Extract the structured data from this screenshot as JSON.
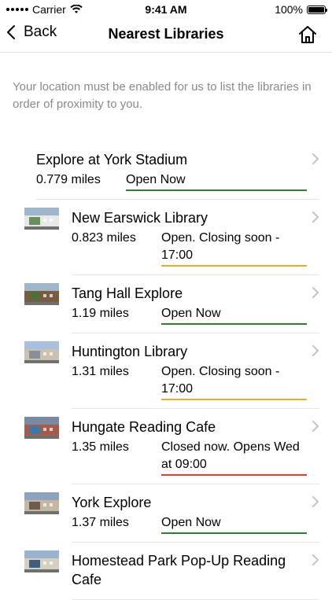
{
  "status_bar": {
    "carrier": "Carrier",
    "time": "9:41 AM",
    "battery": "100%"
  },
  "nav": {
    "back_label": "Back",
    "title": "Nearest Libraries"
  },
  "notice": "Your location must be enabled for us to list the libraries in order of proximity to you.",
  "colors": {
    "open": "#2e7d32",
    "closing": "#f5a623",
    "closed": "#e53935"
  },
  "libraries": [
    {
      "name": "Explore at York Stadium",
      "distance": "0.779 miles",
      "status": "Open Now",
      "status_type": "open",
      "has_thumb": false
    },
    {
      "name": "New Earswick Library",
      "distance": "0.823 miles",
      "status": "Open. Closing soon - 17:00",
      "status_type": "closing",
      "has_thumb": true
    },
    {
      "name": "Tang Hall Explore",
      "distance": "1.19 miles",
      "status": "Open Now",
      "status_type": "open",
      "has_thumb": true
    },
    {
      "name": "Huntington Library",
      "distance": "1.31 miles",
      "status": "Open. Closing soon - 17:00",
      "status_type": "closing",
      "has_thumb": true
    },
    {
      "name": "Hungate Reading Cafe",
      "distance": "1.35 miles",
      "status": "Closed now. Opens Wed at 09:00",
      "status_type": "closed",
      "has_thumb": true
    },
    {
      "name": "York Explore",
      "distance": "1.37 miles",
      "status": "Open Now",
      "status_type": "open",
      "has_thumb": true
    },
    {
      "name": "Homestead Park Pop-Up Reading Cafe",
      "distance": "",
      "status": "",
      "status_type": "open",
      "has_thumb": true
    }
  ]
}
